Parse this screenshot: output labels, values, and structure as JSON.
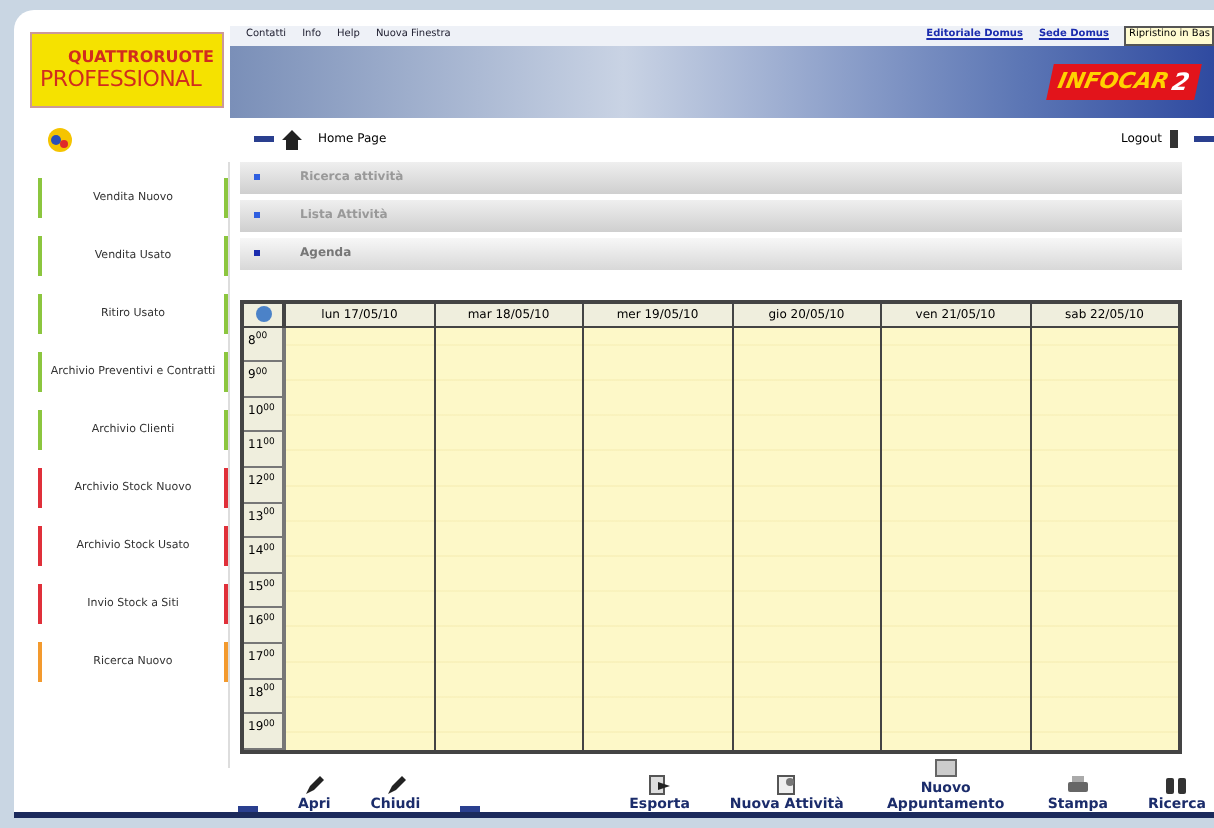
{
  "header": {
    "logo_top": "QUATTRORUOTE",
    "logo_bottom": "PROFESSIONAL",
    "links": [
      "Contatti",
      "Info",
      "Help",
      "Nuova Finestra"
    ],
    "right_links": [
      "Editoriale Domus",
      "Sede Domus"
    ],
    "right_button": "Ripristino in Bas",
    "brand": "INFOCAR",
    "brand_badge": "2"
  },
  "toolbar": {
    "breadcrumb": "Home Page",
    "logout": "Logout"
  },
  "sidebar": {
    "items": [
      {
        "label": "Vendita Nuovo",
        "color": "#8cc63f"
      },
      {
        "label": "Vendita Usato",
        "color": "#8cc63f"
      },
      {
        "label": "Ritiro Usato",
        "color": "#8cc63f"
      },
      {
        "label": "Archivio Preventivi e Contratti",
        "color": "#8cc63f"
      },
      {
        "label": "Archivio Clienti",
        "color": "#8cc63f"
      },
      {
        "label": "Archivio Stock Nuovo",
        "color": "#e0303a"
      },
      {
        "label": "Archivio Stock Usato",
        "color": "#e0303a"
      },
      {
        "label": "Invio Stock a Siti",
        "color": "#e0303a"
      },
      {
        "label": "Ricerca Nuovo",
        "color": "#f39a2e"
      }
    ]
  },
  "sections": [
    {
      "label": "Ricerca attività",
      "expanded": false
    },
    {
      "label": "Lista Attività",
      "expanded": false
    },
    {
      "label": "Agenda",
      "expanded": true
    }
  ],
  "calendar": {
    "columns": [
      "lun 17/05/10",
      "mar 18/05/10",
      "mer 19/05/10",
      "gio 20/05/10",
      "ven 21/05/10",
      "sab 22/05/10"
    ],
    "hours": [
      "8$^{00}$",
      "9$^{00}$",
      "10$^{00}$",
      "11$^{00}$",
      "12$^{00}$",
      "13$^{00}$",
      "14$^{00}$",
      "15$^{00}$",
      "16$^{00}$",
      "17$^{00}$",
      "18$^{00}$",
      "19$^{00}$"
    ]
  },
  "bottom_bar": {
    "left": [
      {
        "label": "Apri",
        "kind": "pen"
      },
      {
        "label": "Chiudi",
        "kind": "pen"
      }
    ],
    "right": [
      {
        "label": "Esporta",
        "kind": "export"
      },
      {
        "label": "Nuova Attività",
        "kind": "doc"
      },
      {
        "label": "Nuovo Appuntamento",
        "kind": "screen"
      },
      {
        "label": "Stampa",
        "kind": "print"
      },
      {
        "label": "Ricerca",
        "kind": "binoculars"
      }
    ]
  }
}
